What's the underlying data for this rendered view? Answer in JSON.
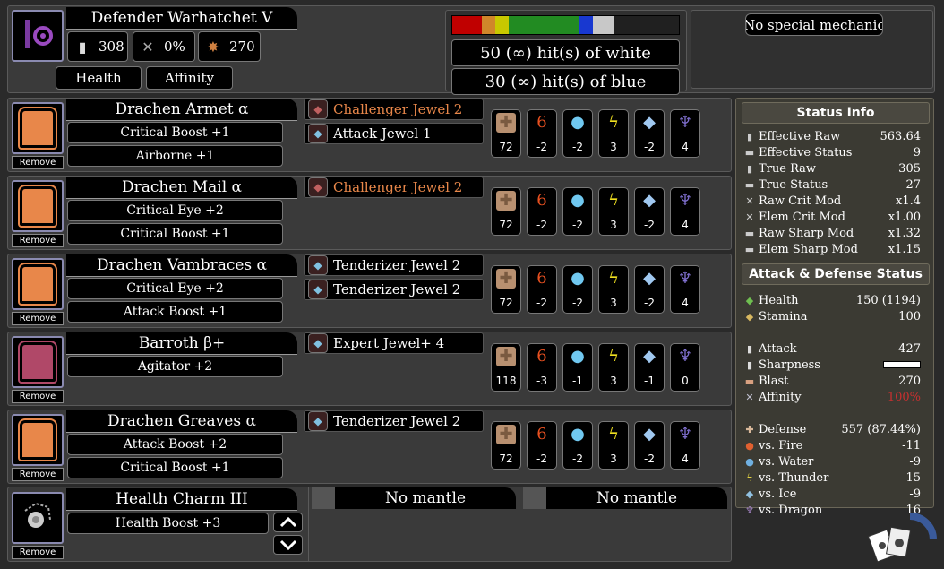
{
  "weapon": {
    "name": "Defender Warhatchet V",
    "stats": [
      {
        "icon": "attack-icon",
        "value": "308"
      },
      {
        "icon": "affinity-icon",
        "value": "0%"
      },
      {
        "icon": "blast-icon",
        "value": "270"
      }
    ],
    "buttons": [
      "Health",
      "Affinity"
    ],
    "sharpness": {
      "colors": [
        "#c00000",
        "#d0862a",
        "#c8c800",
        "#228b22",
        "#1838d0",
        "#c8c8c8",
        "#202020"
      ],
      "widths": [
        11,
        5,
        5,
        26,
        5,
        8,
        24
      ],
      "hits": [
        "50 (∞) hit(s) of white",
        "30 (∞) hit(s) of blue"
      ]
    },
    "mechanic": "No special mechanic"
  },
  "armor": [
    {
      "name": "Drachen Armet α",
      "skills": [
        "Critical Boost +1",
        "Airborne +1"
      ],
      "jewels": [
        {
          "label": "Challenger Jewel 2",
          "color": "#e8874a"
        },
        {
          "label": "Attack Jewel 1",
          "color": "#ffffff"
        }
      ],
      "res": [
        "72",
        "-2",
        "-2",
        "3",
        "-2",
        "4"
      ],
      "remove": "Remove",
      "icon": "helmet-icon"
    },
    {
      "name": "Drachen Mail α",
      "skills": [
        "Critical Eye +2",
        "Critical Boost +1"
      ],
      "jewels": [
        {
          "label": "Challenger Jewel 2",
          "color": "#e8874a"
        }
      ],
      "res": [
        "72",
        "-2",
        "-2",
        "3",
        "-2",
        "4"
      ],
      "remove": "Remove",
      "icon": "chest-icon"
    },
    {
      "name": "Drachen Vambraces α",
      "skills": [
        "Critical Eye +2",
        "Attack Boost +1"
      ],
      "jewels": [
        {
          "label": "Tenderizer Jewel 2",
          "color": "#ffffff"
        },
        {
          "label": "Tenderizer Jewel 2",
          "color": "#ffffff"
        }
      ],
      "res": [
        "72",
        "-2",
        "-2",
        "3",
        "-2",
        "4"
      ],
      "remove": "Remove",
      "icon": "arm-icon"
    },
    {
      "name": "Barroth β+",
      "skills": [
        "Agitator +2"
      ],
      "jewels": [
        {
          "label": "Expert Jewel+ 4",
          "color": "#ffffff"
        }
      ],
      "res": [
        "118",
        "-3",
        "-1",
        "3",
        "-1",
        "0"
      ],
      "remove": "Remove",
      "icon": "waist-icon"
    },
    {
      "name": "Drachen Greaves α",
      "skills": [
        "Attack Boost +2",
        "Critical Boost +1"
      ],
      "jewels": [
        {
          "label": "Tenderizer Jewel 2",
          "color": "#ffffff"
        }
      ],
      "res": [
        "72",
        "-2",
        "-2",
        "3",
        "-2",
        "4"
      ],
      "remove": "Remove",
      "icon": "leg-icon"
    }
  ],
  "charm": {
    "name": "Health Charm III",
    "skill": "Health Boost +3",
    "remove": "Remove",
    "mantles": [
      "No mantle",
      "No mantle"
    ]
  },
  "status_info": {
    "title": "Status Info",
    "rows": [
      {
        "icon": "raw-icon",
        "label": "Effective Raw",
        "value": "563.64"
      },
      {
        "icon": "status-icon",
        "label": "Effective Status",
        "value": "9"
      },
      {
        "icon": "raw-icon",
        "label": "True Raw",
        "value": "305"
      },
      {
        "icon": "status-icon",
        "label": "True Status",
        "value": "27"
      },
      {
        "icon": "crit-icon",
        "label": "Raw Crit Mod",
        "value": "x1.4"
      },
      {
        "icon": "crit-icon",
        "label": "Elem Crit Mod",
        "value": "x1.00"
      },
      {
        "icon": "sharp-icon",
        "label": "Raw Sharp Mod",
        "value": "x1.32"
      },
      {
        "icon": "sharp-icon",
        "label": "Elem Sharp Mod",
        "value": "x1.15"
      }
    ]
  },
  "attack_defense": {
    "title": "Attack & Defense Status",
    "rows": [
      {
        "icon": "health-icon",
        "label": "Health",
        "value": "150 (1194)",
        "color": "#ffffff",
        "iconColor": "#6fbf50"
      },
      {
        "icon": "stamina-icon",
        "label": "Stamina",
        "value": "100",
        "color": "#ffffff",
        "iconColor": "#d8b860"
      },
      {
        "icon": "attack-icon",
        "label": "Attack",
        "value": "427",
        "color": "#ffffff",
        "iconColor": "#dddddd"
      },
      {
        "icon": "sharpness-icon",
        "label": "Sharpness",
        "value": "",
        "color": "#ffffff",
        "iconColor": "#dddddd"
      },
      {
        "icon": "blast-icon",
        "label": "Blast",
        "value": "270",
        "color": "#ffffff",
        "iconColor": "#d8a080"
      },
      {
        "icon": "affinity-icon",
        "label": "Affinity",
        "value": "100%",
        "color": "#c83030",
        "iconColor": "#c0c0d0"
      },
      {
        "icon": "defense-icon",
        "label": "Defense",
        "value": "557 (87.44%)",
        "color": "#ffffff",
        "iconColor": "#d8b89a"
      },
      {
        "icon": "fire-icon",
        "label": "vs. Fire",
        "value": "-11",
        "color": "#ffffff",
        "iconColor": "#e06030"
      },
      {
        "icon": "water-icon",
        "label": "vs. Water",
        "value": "-9",
        "color": "#ffffff",
        "iconColor": "#70b0e0"
      },
      {
        "icon": "thunder-icon",
        "label": "vs. Thunder",
        "value": "15",
        "color": "#ffffff",
        "iconColor": "#e0d040"
      },
      {
        "icon": "ice-icon",
        "label": "vs. Ice",
        "value": "-9",
        "color": "#ffffff",
        "iconColor": "#90c0e0"
      },
      {
        "icon": "dragon-icon",
        "label": "vs. Dragon",
        "value": "16",
        "color": "#ffffff",
        "iconColor": "#a080c0"
      }
    ]
  },
  "res_icons": [
    {
      "name": "defense-icon",
      "glyph": "✚",
      "color": "#c8a888"
    },
    {
      "name": "fire-icon",
      "glyph": "6",
      "color": "#e85020"
    },
    {
      "name": "water-icon",
      "glyph": "●",
      "color": "#70c8f0"
    },
    {
      "name": "thunder-icon",
      "glyph": "ϟ",
      "color": "#f0e020"
    },
    {
      "name": "ice-icon",
      "glyph": "◆",
      "color": "#a0c8f0"
    },
    {
      "name": "dragon-icon",
      "glyph": "♆",
      "color": "#8070d0"
    }
  ]
}
